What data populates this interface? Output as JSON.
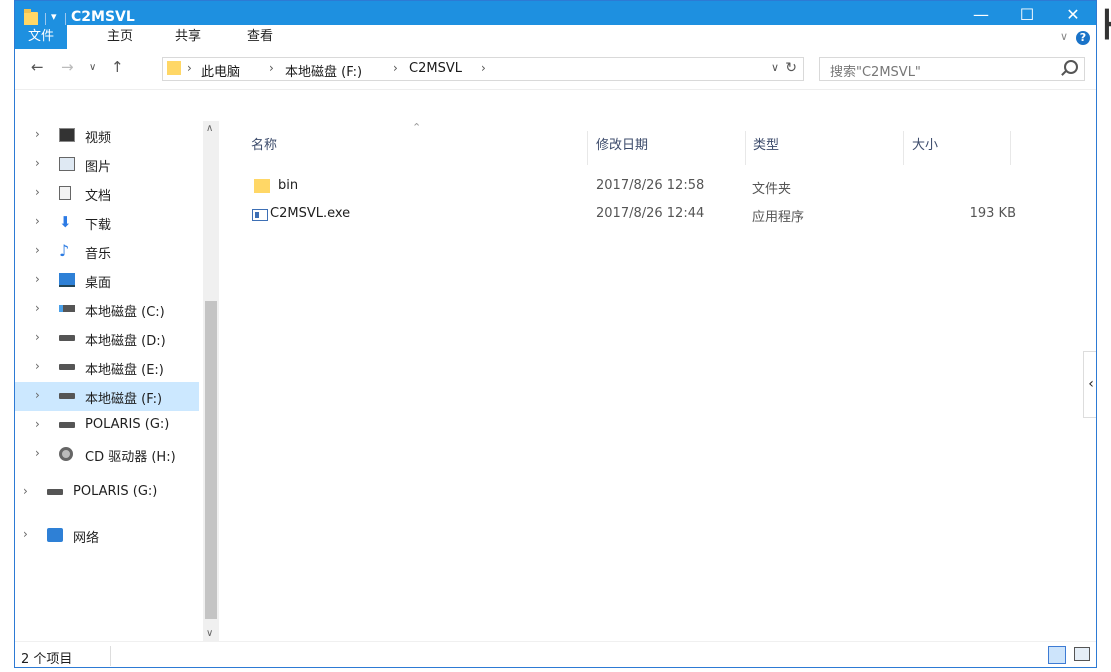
{
  "window": {
    "title": "C2MSVL"
  },
  "controls": {
    "minimize": "—",
    "maximize": "☐",
    "close": "✕"
  },
  "ribbon": {
    "tabs": [
      "文件",
      "主页",
      "共享",
      "查看"
    ],
    "help": "?"
  },
  "address": {
    "crumbs": [
      "此电脑",
      "本地磁盘 (F:)",
      "C2MSVL"
    ],
    "search_placeholder": "搜索\"C2MSVL\""
  },
  "sidebar": {
    "items": [
      {
        "label": "视频",
        "icon": "video-icon"
      },
      {
        "label": "图片",
        "icon": "pictures-icon"
      },
      {
        "label": "文档",
        "icon": "documents-icon"
      },
      {
        "label": "下载",
        "icon": "download-icon"
      },
      {
        "label": "音乐",
        "icon": "music-icon"
      },
      {
        "label": "桌面",
        "icon": "desktop-icon"
      },
      {
        "label": "本地磁盘 (C:)",
        "icon": "system-drive-icon"
      },
      {
        "label": "本地磁盘 (D:)",
        "icon": "drive-icon"
      },
      {
        "label": "本地磁盘 (E:)",
        "icon": "drive-icon"
      },
      {
        "label": "本地磁盘 (F:)",
        "icon": "drive-icon",
        "selected": true
      },
      {
        "label": "POLARIS (G:)",
        "icon": "drive-icon"
      },
      {
        "label": "CD 驱动器 (H:)",
        "icon": "cd-drive-icon"
      },
      {
        "label": "POLARIS (G:)",
        "icon": "drive-icon"
      },
      {
        "label": "网络",
        "icon": "network-icon"
      }
    ]
  },
  "columns": {
    "name": "名称",
    "date": "修改日期",
    "type": "类型",
    "size": "大小"
  },
  "files": [
    {
      "name": "bin",
      "date": "2017/8/26 12:58",
      "type": "文件夹",
      "size": "",
      "icon": "folder-icon"
    },
    {
      "name": "C2MSVL.exe",
      "date": "2017/8/26 12:44",
      "type": "应用程序",
      "size": "193 KB",
      "icon": "exe-icon"
    }
  ],
  "status": {
    "count": "2 个项目"
  }
}
